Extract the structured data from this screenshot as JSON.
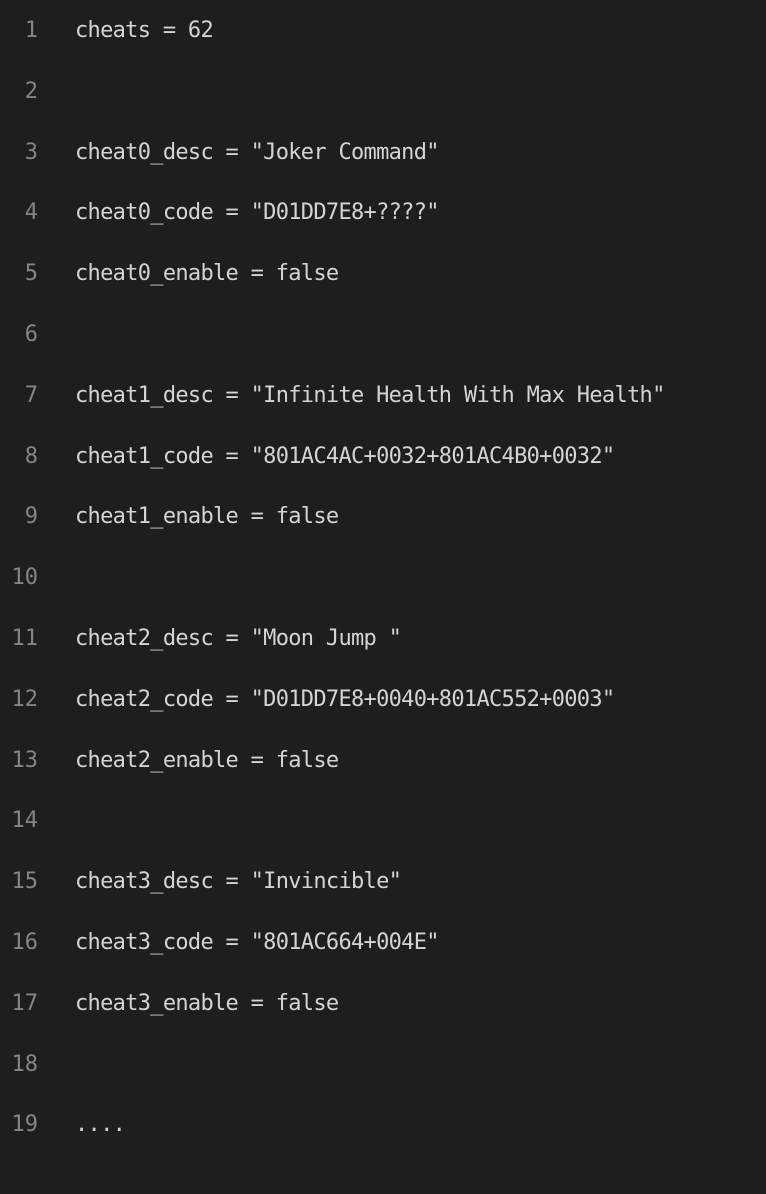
{
  "editor": {
    "lines": [
      {
        "number": "1",
        "text": "cheats = 62"
      },
      {
        "number": "2",
        "text": ""
      },
      {
        "number": "3",
        "text": "cheat0_desc = \"Joker Command\""
      },
      {
        "number": "4",
        "text": "cheat0_code = \"D01DD7E8+????\""
      },
      {
        "number": "5",
        "text": "cheat0_enable = false"
      },
      {
        "number": "6",
        "text": ""
      },
      {
        "number": "7",
        "text": "cheat1_desc = \"Infinite Health With Max Health\""
      },
      {
        "number": "8",
        "text": "cheat1_code = \"801AC4AC+0032+801AC4B0+0032\""
      },
      {
        "number": "9",
        "text": "cheat1_enable = false"
      },
      {
        "number": "10",
        "text": ""
      },
      {
        "number": "11",
        "text": "cheat2_desc = \"Moon Jump \""
      },
      {
        "number": "12",
        "text": "cheat2_code = \"D01DD7E8+0040+801AC552+0003\""
      },
      {
        "number": "13",
        "text": "cheat2_enable = false"
      },
      {
        "number": "14",
        "text": ""
      },
      {
        "number": "15",
        "text": "cheat3_desc = \"Invincible\""
      },
      {
        "number": "16",
        "text": "cheat3_code = \"801AC664+004E\""
      },
      {
        "number": "17",
        "text": "cheat3_enable = false"
      },
      {
        "number": "18",
        "text": ""
      },
      {
        "number": "19",
        "text": "...."
      }
    ]
  },
  "colors": {
    "background": "#1e1e1e",
    "text": "#d4d4d4",
    "line_number": "#858585"
  }
}
